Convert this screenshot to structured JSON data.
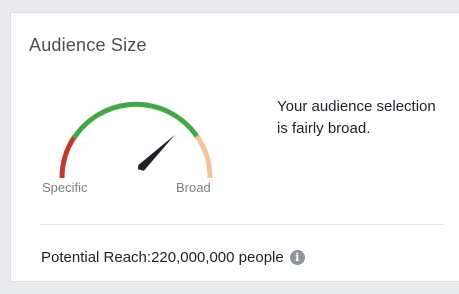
{
  "card": {
    "title": "Audience Size"
  },
  "gauge": {
    "label_left": "Specific",
    "label_right": "Broad",
    "level": 0.78,
    "colors": {
      "specific": "#c0392b",
      "ideal": "#42a845",
      "broad": "#f2c49a",
      "needle": "#1d2129"
    }
  },
  "summary": {
    "text": "Your audience selection is fairly broad."
  },
  "reach": {
    "label": "Potential Reach:",
    "value": "220,000,000 people",
    "info_icon": "info-icon"
  }
}
